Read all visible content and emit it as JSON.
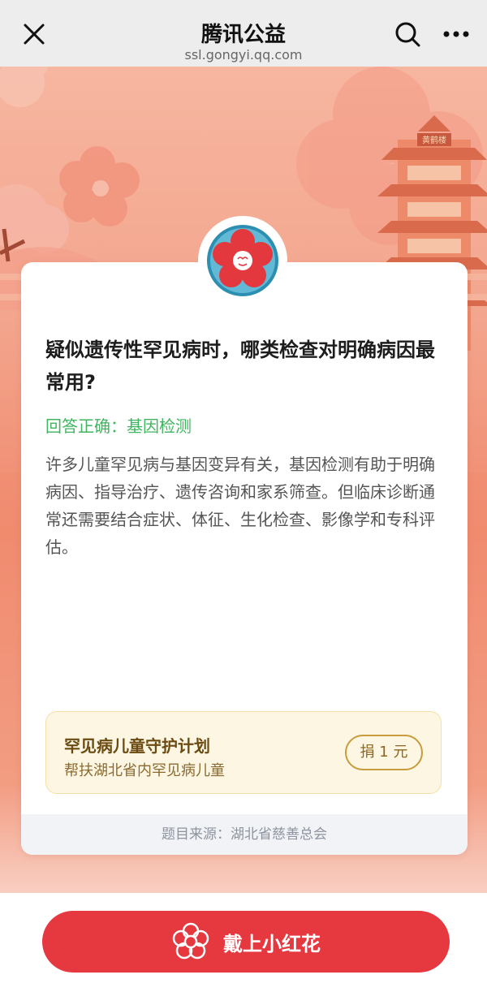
{
  "header": {
    "title": "腾讯公益",
    "url": "ssl.gongyi.qq.com"
  },
  "quiz": {
    "question": "疑似遗传性罕见病时，哪类检查对明确病因最常用?",
    "answer_label": "回答正确：基因检测",
    "explanation": "许多儿童罕见病与基因变异有关，基因检测有助于明确病因、指导治疗、遗传咨询和家系筛查。但临床诊断通常还需要结合症状、体征、生化检查、影像学和专科评估。"
  },
  "project": {
    "name": "罕见病儿童守护计划",
    "description": "帮扶湖北省内罕见病儿童",
    "donate_label": "捐 1 元"
  },
  "source": "题目来源：湖北省慈善总会",
  "action": {
    "button_label": "戴上小红花"
  },
  "scene": {
    "tower_sign": "黄鹤楼"
  },
  "colors": {
    "accent_red": "#e5383f",
    "success_green": "#3fb55f",
    "hero_coral": "#f08a6e"
  },
  "icons": [
    "close-icon",
    "search-icon",
    "more-icon",
    "red-flower-icon"
  ]
}
